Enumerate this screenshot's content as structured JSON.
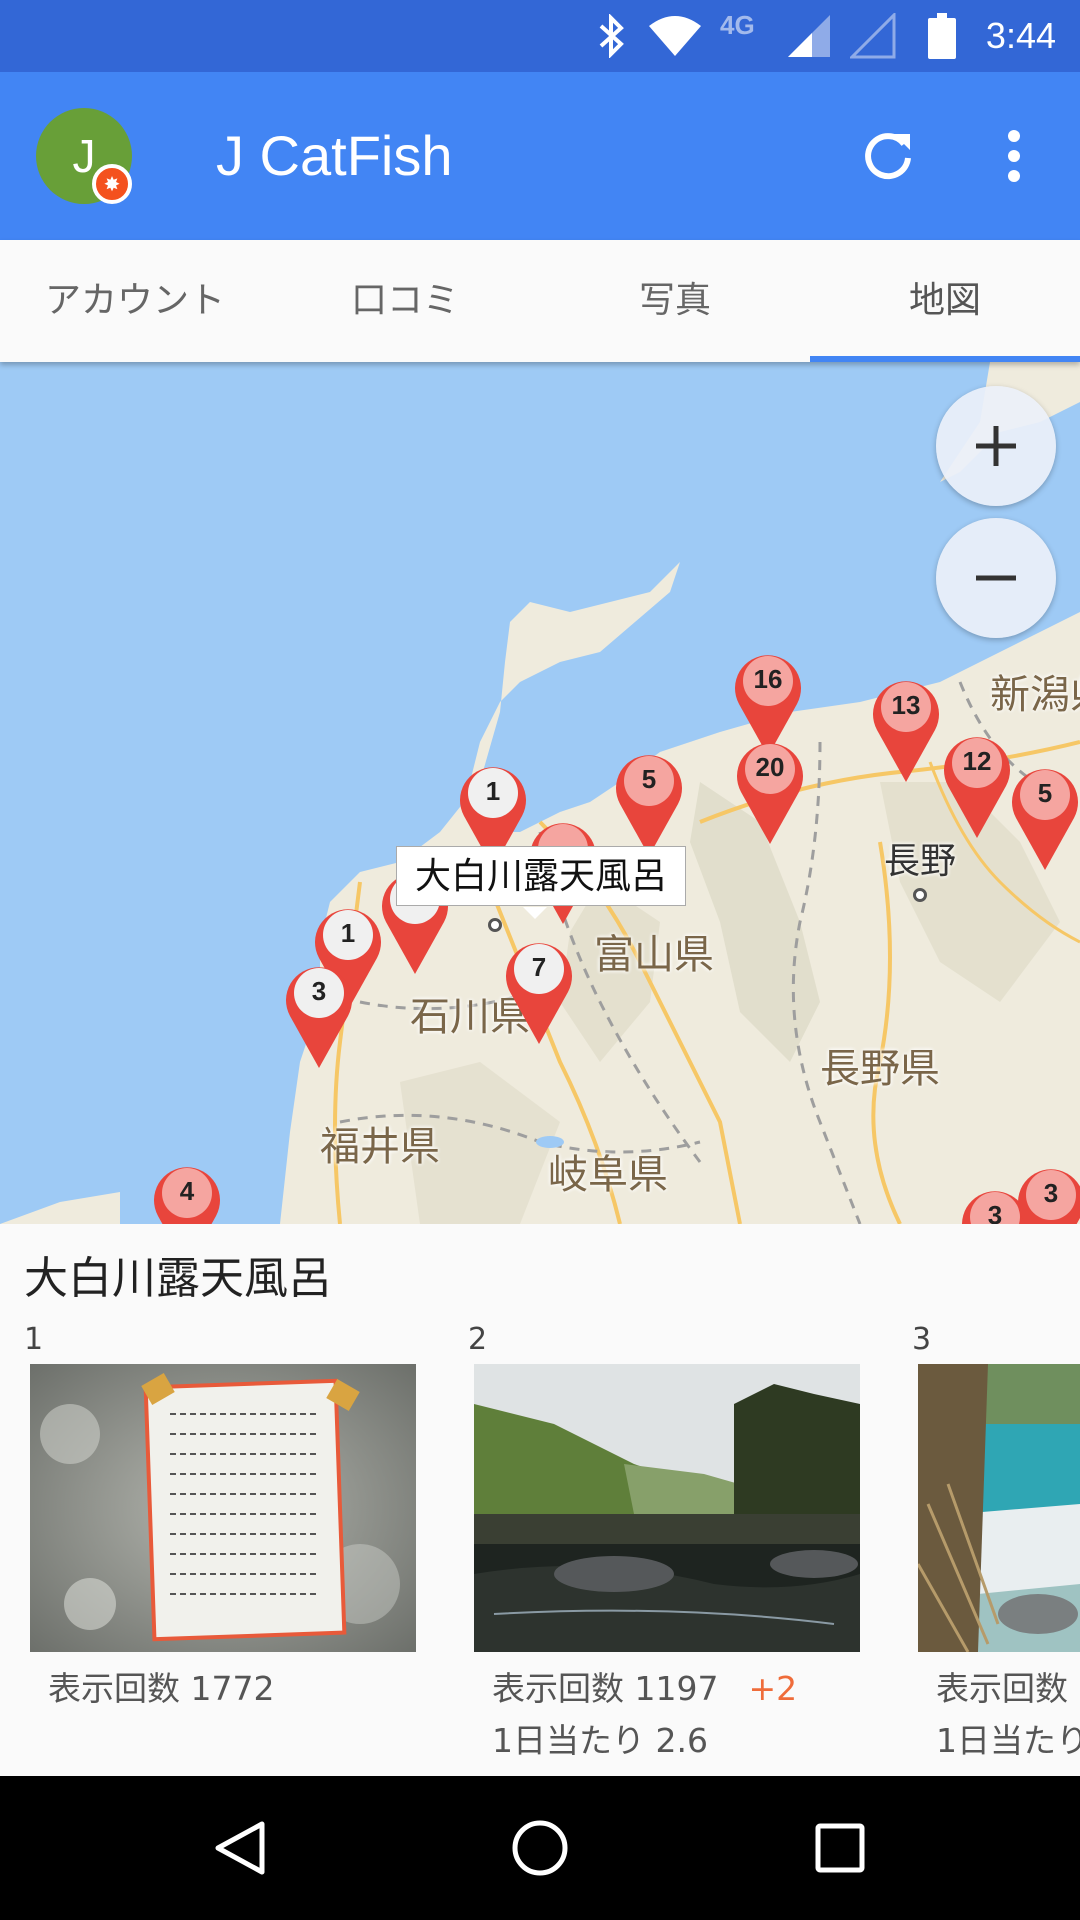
{
  "status_bar": {
    "time": "3:44",
    "network": "4G",
    "icons": [
      "bluetooth-icon",
      "wifi-icon",
      "cell-signal-icon",
      "battery-icon"
    ]
  },
  "app_bar": {
    "avatar_letter": "J",
    "title": "J CatFish",
    "actions": [
      "refresh-icon",
      "more-vert-icon"
    ],
    "color": "#4285f4"
  },
  "tabs": [
    {
      "label": "アカウント",
      "active": false
    },
    {
      "label": "口コミ",
      "active": false
    },
    {
      "label": "写真",
      "active": false
    },
    {
      "label": "地図",
      "active": true
    }
  ],
  "map": {
    "zoom_in": "+",
    "zoom_out": "−",
    "tooltip": "大白川露天風呂",
    "places": {
      "niigata": "新潟県",
      "nagano_city": "長野",
      "toyama": "富山県",
      "ishikawa": "石川県",
      "nagano_pref": "長野県",
      "fukui": "福井県",
      "gifu": "岐阜県"
    },
    "pins": [
      "16",
      "13",
      "20",
      "1",
      "5",
      "12",
      "5",
      "1",
      "1",
      "3",
      "7",
      "4",
      "3",
      "3"
    ]
  },
  "panel": {
    "title": "大白川露天風呂",
    "cards": [
      {
        "index": "1",
        "views": "表示回数 1772",
        "delta": "",
        "per_day": ""
      },
      {
        "index": "2",
        "views": "表示回数 1197",
        "delta": "+2",
        "per_day": "1日当たり 2.6"
      },
      {
        "index": "3",
        "views": "表示回数",
        "delta": "",
        "per_day": "1日当たり"
      }
    ]
  },
  "nav": [
    "back-icon",
    "home-icon",
    "recents-icon"
  ]
}
